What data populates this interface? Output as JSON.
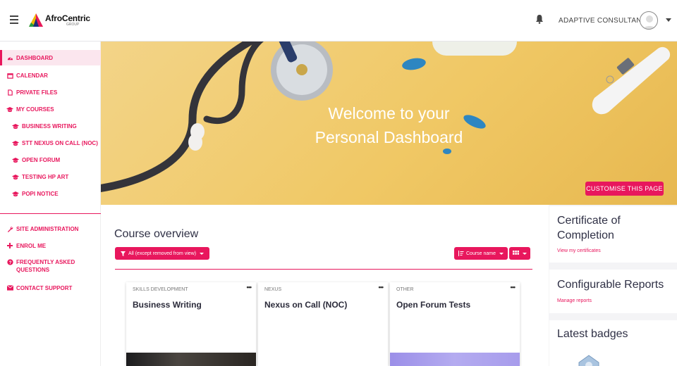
{
  "header": {
    "brand_name": "AfroCentric",
    "brand_sub": "GROUP",
    "username": "ADAPTIVE CONSULTANTS"
  },
  "sidebar": {
    "items": [
      {
        "label": "DASHBOARD",
        "icon": "dashboard-icon"
      },
      {
        "label": "CALENDAR",
        "icon": "calendar-icon"
      },
      {
        "label": "PRIVATE FILES",
        "icon": "file-icon"
      },
      {
        "label": "MY COURSES",
        "icon": "graduation-cap-icon"
      },
      {
        "label": "BUSINESS WRITING",
        "icon": "graduation-cap-icon"
      },
      {
        "label": "STT NEXUS ON CALL (NOC)",
        "icon": "graduation-cap-icon"
      },
      {
        "label": "OPEN FORUM",
        "icon": "graduation-cap-icon"
      },
      {
        "label": "TESTING HP ART",
        "icon": "graduation-cap-icon"
      },
      {
        "label": "POPI NOTICE",
        "icon": "graduation-cap-icon"
      }
    ],
    "items2": [
      {
        "label": "SITE ADMINISTRATION",
        "icon": "wrench-icon"
      },
      {
        "label": "ENROL ME",
        "icon": "plus-icon"
      },
      {
        "label": "FREQUENTLY ASKED QUESTIONS",
        "icon": "question-icon"
      },
      {
        "label": "CONTACT SUPPORT",
        "icon": "envelope-icon"
      }
    ]
  },
  "hero": {
    "title_line1": "Welcome to your",
    "title_line2": "Personal Dashboard",
    "customise_label": "CUSTOMISE THIS PAGE"
  },
  "course_overview": {
    "title": "Course overview",
    "filter_label": "All (except removed from view)",
    "sort_label": "Course name",
    "courses": [
      {
        "category": "SKILLS DEVELOPMENT",
        "name": "Business Writing"
      },
      {
        "category": "NEXUS",
        "name": "Nexus on Call (NOC)"
      },
      {
        "category": "OTHER",
        "name": "Open Forum Tests"
      }
    ]
  },
  "right_blocks": {
    "certificate_title": "Certificate of Completion",
    "certificate_link": "View my certificates",
    "reports_title": "Configurable Reports",
    "reports_link": "Manage reports",
    "badges_title": "Latest badges"
  },
  "colors": {
    "accent": "#e8175d"
  }
}
